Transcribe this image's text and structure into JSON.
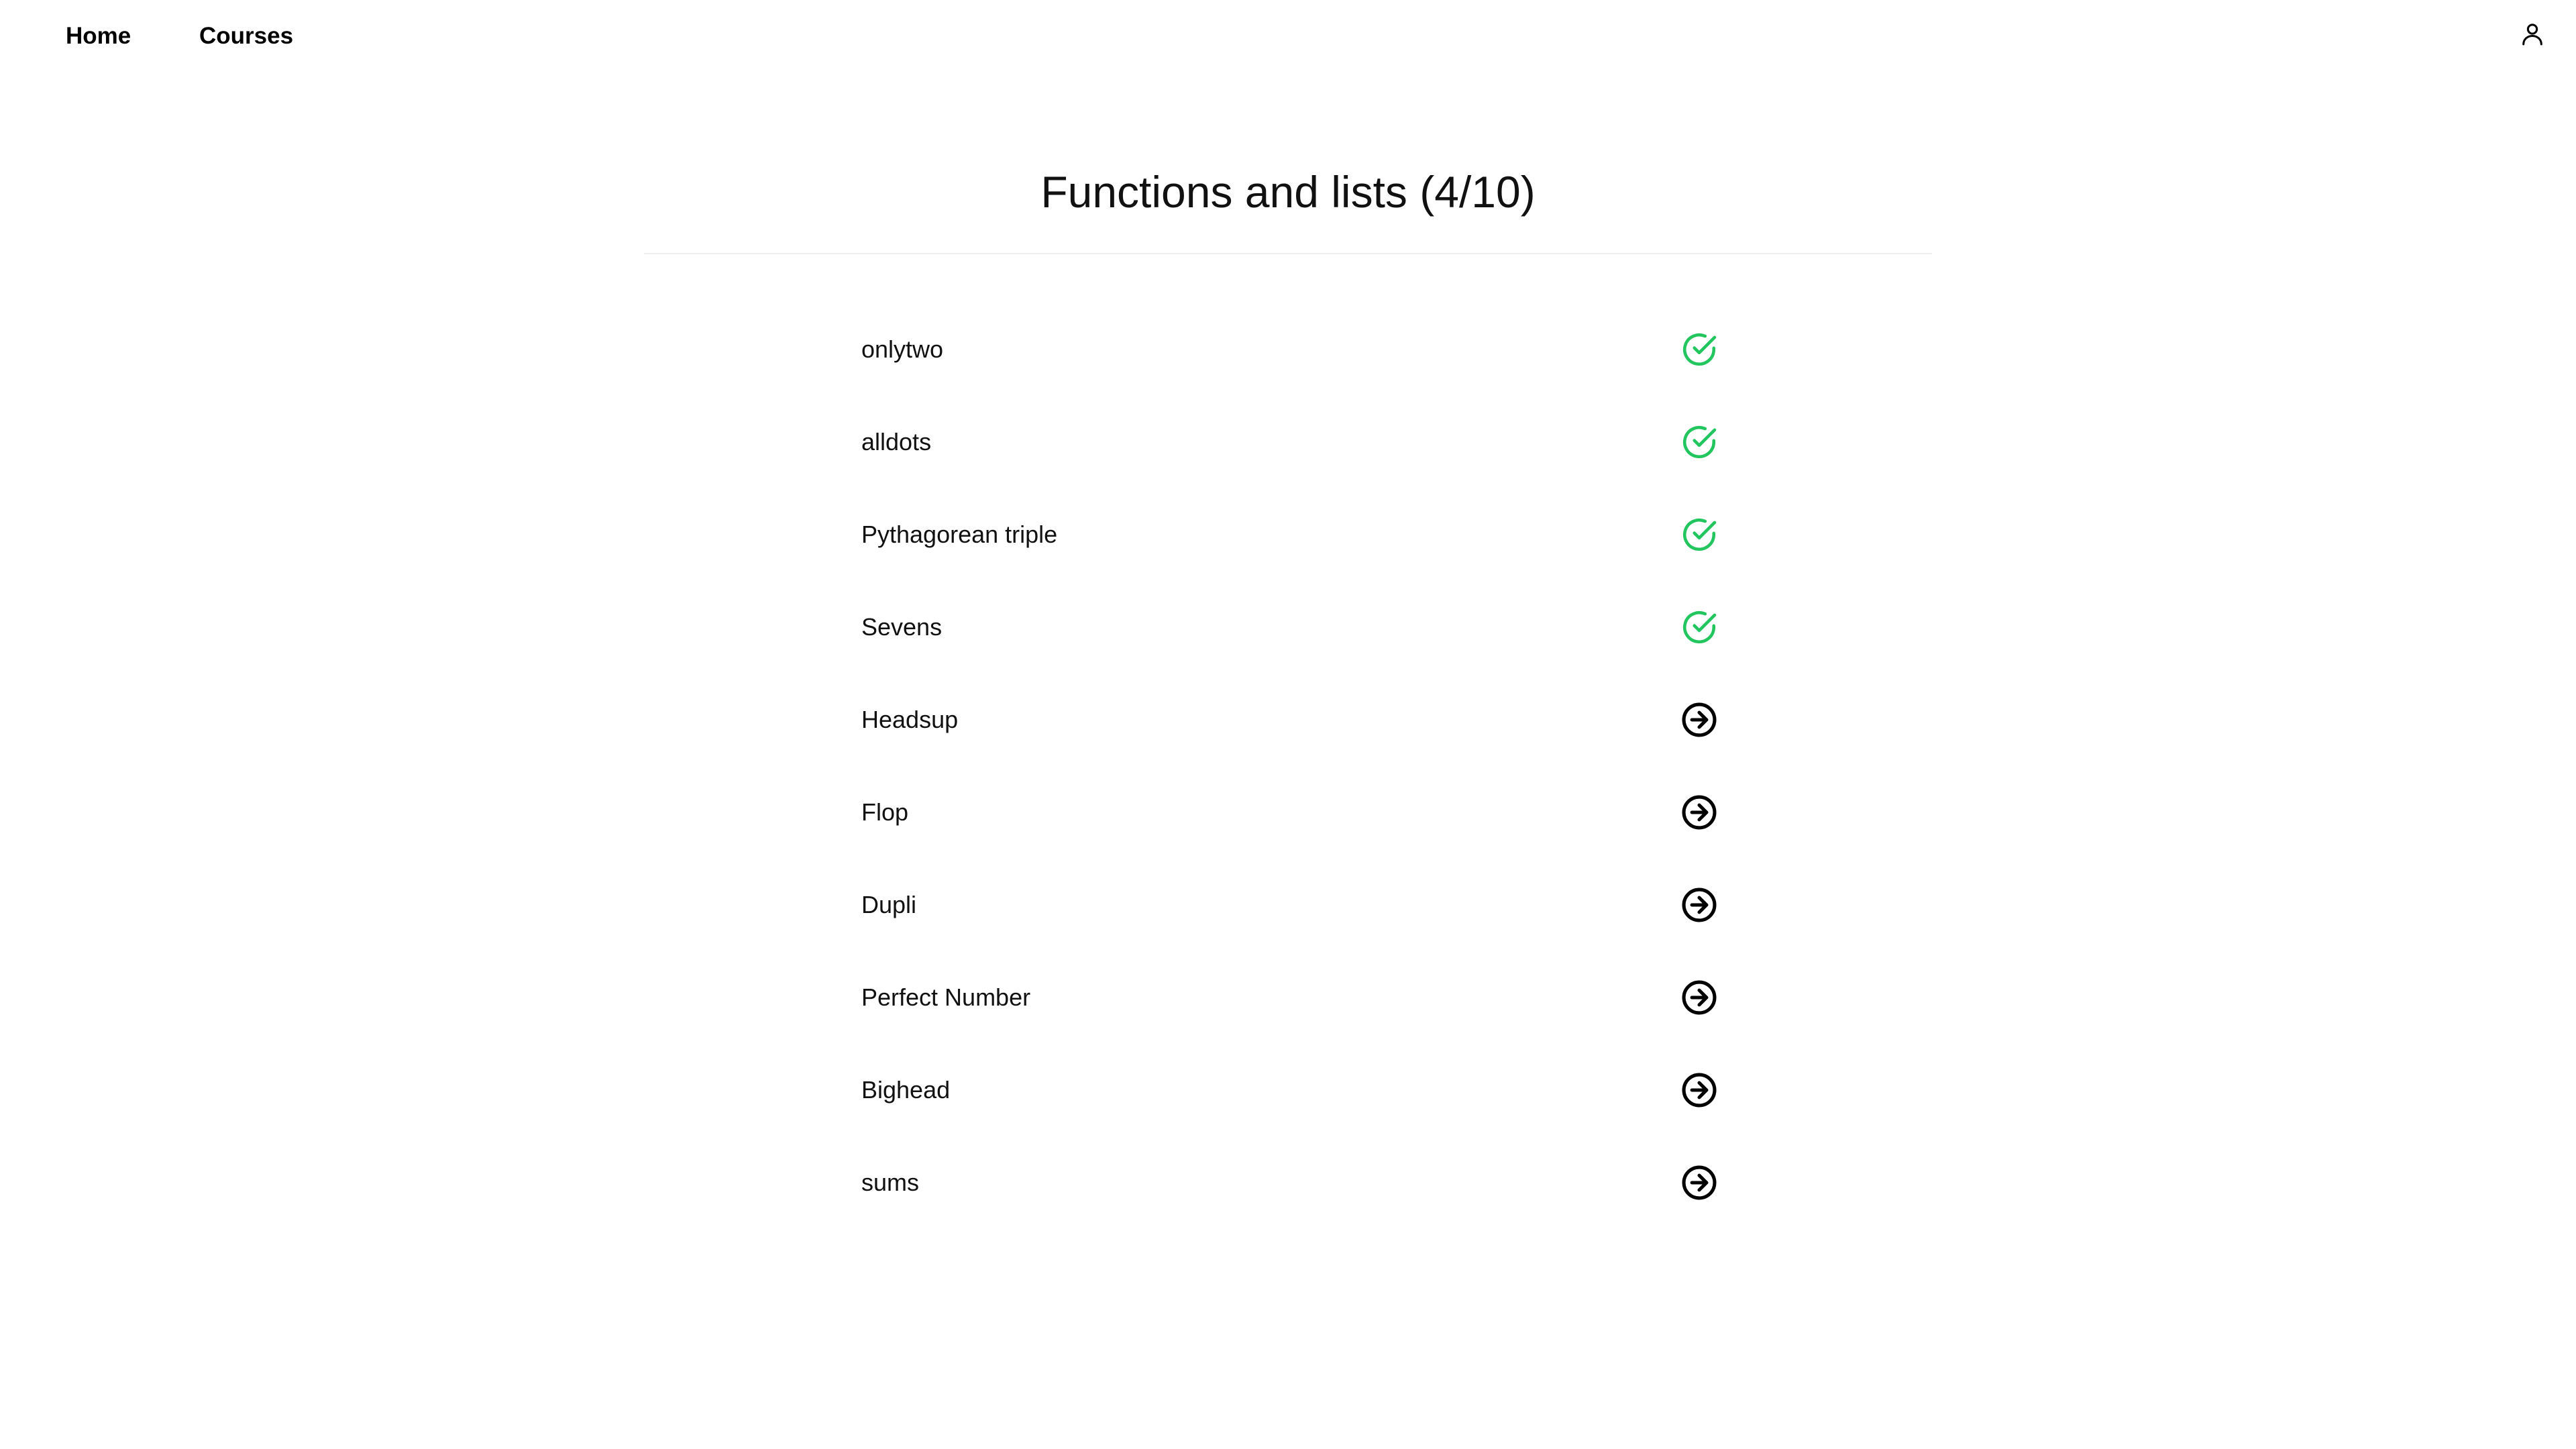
{
  "nav": {
    "home_label": "Home",
    "courses_label": "Courses",
    "user_icon": "user-icon"
  },
  "page": {
    "title": "Functions and lists (4/10)"
  },
  "exercises": [
    {
      "name": "onlytwo",
      "status": "completed",
      "icon": "check-circle-icon"
    },
    {
      "name": "alldots",
      "status": "completed",
      "icon": "check-circle-icon"
    },
    {
      "name": "Pythagorean triple",
      "status": "completed",
      "icon": "check-circle-icon"
    },
    {
      "name": "Sevens",
      "status": "completed",
      "icon": "check-circle-icon"
    },
    {
      "name": "Headsup",
      "status": "open",
      "icon": "arrow-right-circle-icon"
    },
    {
      "name": "Flop",
      "status": "open",
      "icon": "arrow-right-circle-icon"
    },
    {
      "name": "Dupli",
      "status": "open",
      "icon": "arrow-right-circle-icon"
    },
    {
      "name": "Perfect Number",
      "status": "open",
      "icon": "arrow-right-circle-icon"
    },
    {
      "name": "Bighead",
      "status": "open",
      "icon": "arrow-right-circle-icon"
    },
    {
      "name": "sums",
      "status": "open",
      "icon": "arrow-right-circle-icon"
    }
  ],
  "colors": {
    "completed": "#22c55e",
    "open": "#000000",
    "divider": "#eeeeee"
  }
}
